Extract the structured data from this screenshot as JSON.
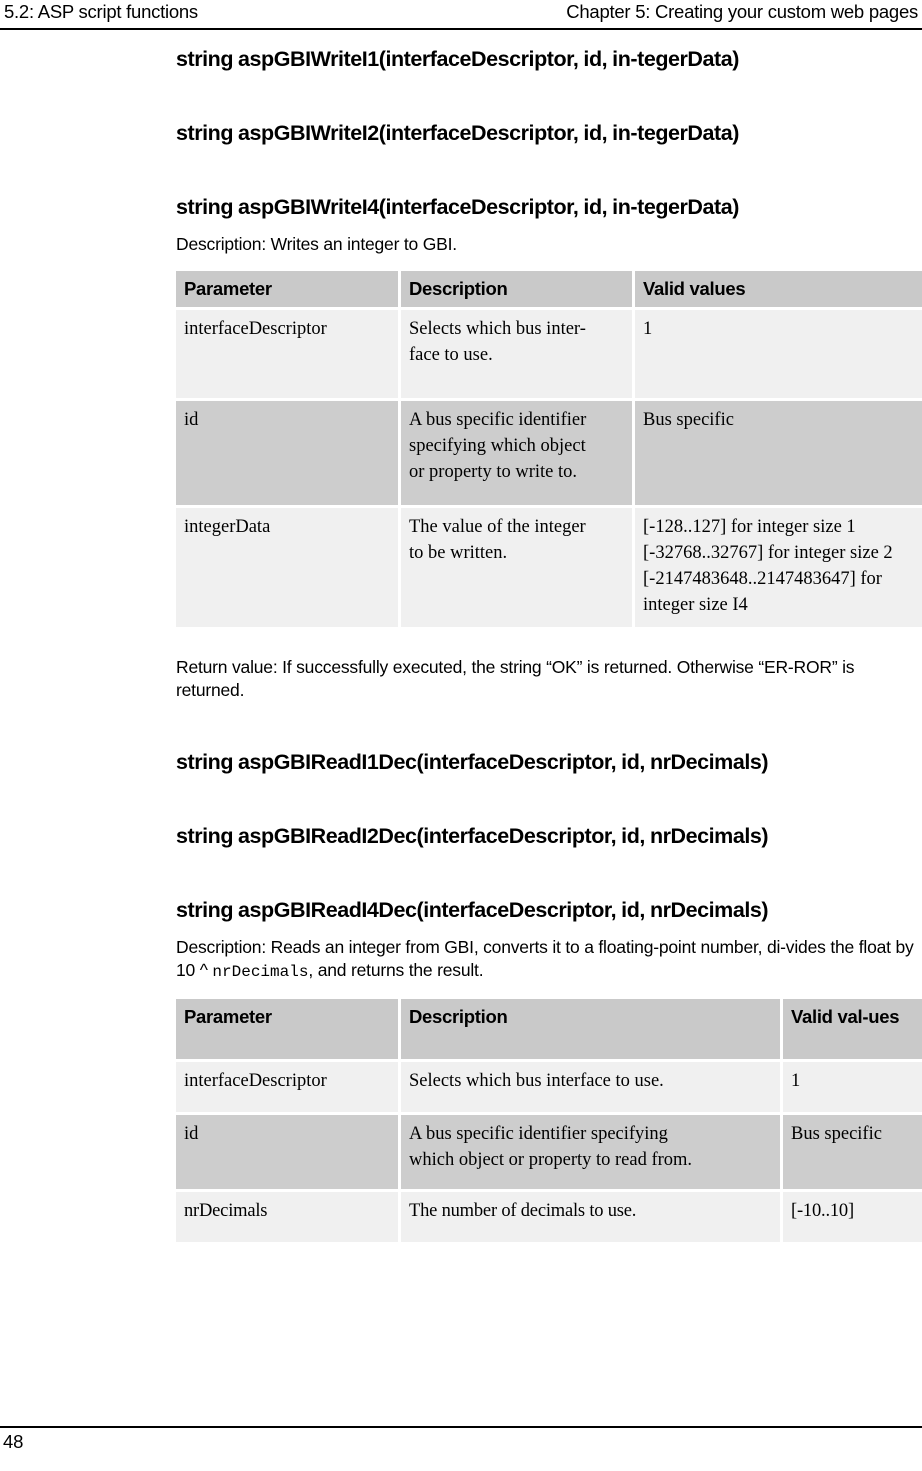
{
  "header": {
    "left": "5.2: ASP script functions",
    "right": "Chapter 5: Creating your custom web pages"
  },
  "footer": {
    "page_number": "48"
  },
  "sections": [
    {
      "headings": [
        "string aspGBIWriteI1(interfaceDescriptor, id, in-tegerData)",
        "string aspGBIWriteI2(interfaceDescriptor, id, in-tegerData)",
        "string aspGBIWriteI4(interfaceDescriptor, id, in-tegerData)"
      ],
      "description": "Description: Writes an integer to GBI.",
      "return_value": "Return value: If successfully executed, the string “OK” is returned. Otherwise “ER-ROR” is returned."
    },
    {
      "headings": [
        "string aspGBIReadI1Dec(interfaceDescriptor, id, nrDecimals)",
        "string aspGBIReadI2Dec(interfaceDescriptor, id, nrDecimals)",
        "string aspGBIReadI4Dec(interfaceDescriptor, id, nrDecimals)"
      ],
      "description_part1": "Description: Reads an integer from GBI, converts it to a floating-point number, di-vides the float by 10 ^ ",
      "description_mono": "nrDecimals",
      "description_part2": ", and returns the result."
    }
  ],
  "table_write": {
    "columns": [
      "Parameter",
      "Description",
      "Valid values"
    ],
    "rows": [
      {
        "parameter": "interfaceDescriptor",
        "description_lines": [
          "Selects which bus inter-",
          "face to use."
        ],
        "valid_lines": [
          "1"
        ]
      },
      {
        "parameter": "id",
        "description_lines": [
          "A bus specific identifier",
          "specifying which object",
          "or property to write to."
        ],
        "valid_lines": [
          "Bus specific"
        ]
      },
      {
        "parameter": "integerData",
        "description_lines": [
          "The value of the integer",
          "to be written."
        ],
        "valid_lines": [
          "[-128..127] for integer size 1",
          "[-32768..32767] for integer size 2",
          "[-2147483648..2147483647] for",
          "integer size I4"
        ]
      }
    ]
  },
  "table_read": {
    "columns": [
      "Parameter",
      "Description",
      "Valid val-ues"
    ],
    "rows": [
      {
        "parameter": "interfaceDescriptor",
        "description_lines": [
          "Selects which bus interface to use."
        ],
        "valid_lines": [
          "1"
        ]
      },
      {
        "parameter": "id",
        "description_lines": [
          "A bus specific identifier specifying",
          "which object or property to read from."
        ],
        "valid_lines": [
          "Bus specific"
        ]
      },
      {
        "parameter": "nrDecimals",
        "description_lines": [
          "The number of decimals to use."
        ],
        "valid_lines": [
          "[-10..10]"
        ]
      }
    ]
  }
}
